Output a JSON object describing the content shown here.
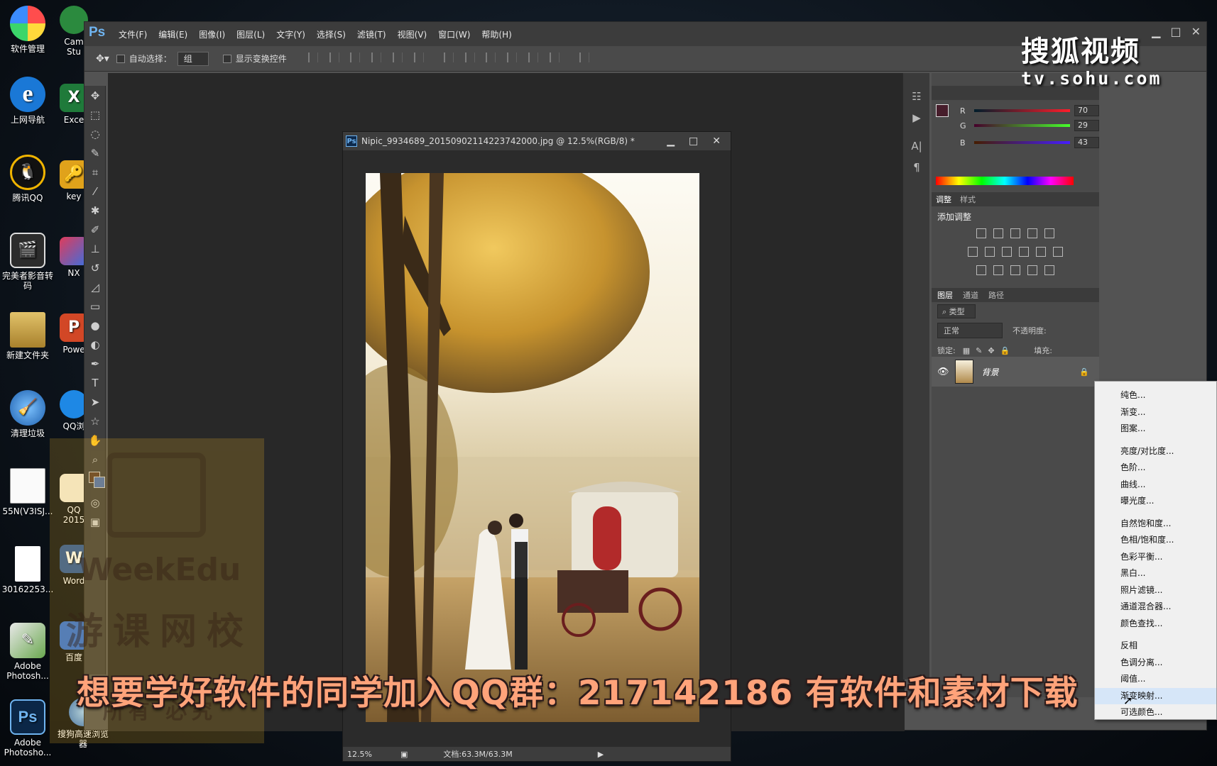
{
  "desktop": {
    "icons_left": [
      {
        "label": "软件管理",
        "icon": "software-manager-icon"
      },
      {
        "label": "上网导航",
        "icon": "ie-icon"
      },
      {
        "label": "腾讯QQ",
        "icon": "qq-icon"
      },
      {
        "label": "完美者影音转\n码",
        "icon": "video-converter-icon"
      },
      {
        "label": "新建文件夹",
        "icon": "folder-icon"
      },
      {
        "label": "清理垃圾",
        "icon": "broom-icon"
      },
      {
        "label": "55N(V3ISJ...",
        "icon": "document-icon"
      },
      {
        "label": "30162253...",
        "icon": "blank-file-icon"
      },
      {
        "label": "Adobe\nPhotosh...",
        "icon": "photoshop-shortcut-icon"
      },
      {
        "label": "Adobe\nPhotosho...",
        "icon": "photoshop-icon"
      }
    ],
    "icons_right": [
      {
        "label": "Cam\nStu",
        "icon": "camtasia-icon"
      },
      {
        "label": "Exce",
        "icon": "excel-icon"
      },
      {
        "label": "key",
        "icon": "key-icon"
      },
      {
        "label": "NX",
        "icon": "nx-icon"
      },
      {
        "label": "Powe",
        "icon": "powerpoint-icon"
      },
      {
        "label": "QQ浏",
        "icon": "qq-browser-icon"
      },
      {
        "label": "QQ\n2015",
        "icon": "qq2015-icon"
      },
      {
        "label": "Word",
        "icon": "word-icon"
      },
      {
        "label": "百度",
        "icon": "baidu-icon"
      },
      {
        "label": "搜狗高速浏览\n器",
        "icon": "sogou-browser-icon"
      }
    ]
  },
  "ps": {
    "logo": "Ps",
    "menu": [
      "文件(F)",
      "编辑(E)",
      "图像(I)",
      "图层(L)",
      "文字(Y)",
      "选择(S)",
      "滤镜(T)",
      "视图(V)",
      "窗口(W)",
      "帮助(H)"
    ],
    "options": {
      "auto_select_label": "自动选择：",
      "auto_select_value": "组",
      "show_transform_label": "显示变换控件"
    },
    "document": {
      "title": "Nipic_9934689_20150902114223742000.jpg @ 12.5%(RGB/8) *",
      "zoom": "12.5%",
      "doc_info": "文档:63.3M/63.3M"
    },
    "color_panel": {
      "r_label": "R",
      "r_value": "70",
      "g_label": "G",
      "g_value": "29",
      "b_label": "B",
      "b_value": "43",
      "fg_color": "#46 1d2b",
      "bg_color": "#4b6fb0"
    },
    "adjust_panel": {
      "tab_active": "调整",
      "tab_other": "样式",
      "heading": "添加调整"
    },
    "layers_panel": {
      "tabs": [
        "图层",
        "通道",
        "路径"
      ],
      "filter_label": "类型",
      "blend_mode": "正常",
      "opacity_label": "不透明度:",
      "lock_label": "锁定:",
      "fill_label": "填充:",
      "layer_name": "背景"
    },
    "adjust_menu": {
      "group1": [
        "纯色...",
        "渐变...",
        "图案..."
      ],
      "group2": [
        "亮度/对比度...",
        "色阶...",
        "曲线...",
        "曝光度..."
      ],
      "group3": [
        "自然饱和度...",
        "色相/饱和度...",
        "色彩平衡...",
        "黑白...",
        "照片滤镜...",
        "通道混合器...",
        "颜色查找..."
      ],
      "group4": [
        "反相",
        "色调分离...",
        "阈值...",
        "渐变映射...",
        "可选颜色..."
      ],
      "highlighted": "渐变映射..."
    }
  },
  "overlay": {
    "sohu_big": "搜狐视频",
    "sohu_small": "tv.sohu.com",
    "watermark_line1": "WeekEdu",
    "watermark_line2": "游课网校",
    "watermark_line3": "所有 必究",
    "subtitle": "想要学好软件的同学加入QQ群：217142186 有软件和素材下载"
  }
}
